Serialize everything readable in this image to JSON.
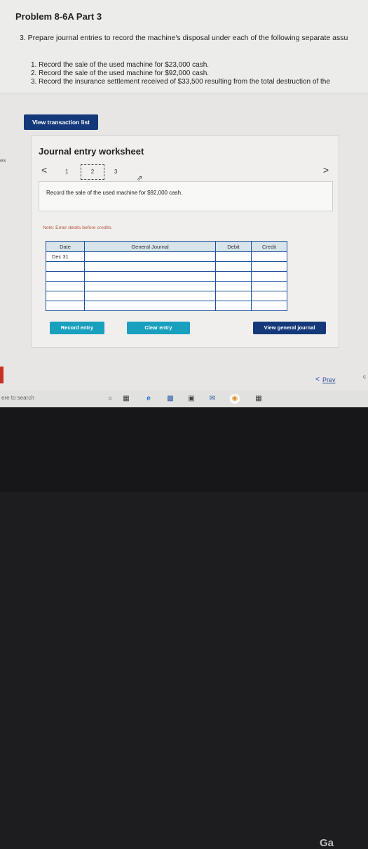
{
  "header": {
    "title": "Problem 8-6A Part 3",
    "question": "3. Prepare journal entries to record the machine's disposal under each of the following separate assu",
    "items": [
      "1. Record the sale of the used machine for $23,000 cash.",
      "2. Record the sale of the used machine for $92,000 cash.",
      "3. Record the insurance settlement received of $33,500 resulting from the total destruction of the"
    ]
  },
  "buttons": {
    "view_transactions": "View transaction list",
    "record_entry": "Record entry",
    "clear_entry": "Clear entry",
    "view_general_journal": "View general journal"
  },
  "left_cut_text": "es",
  "worksheet": {
    "title": "Journal entry worksheet",
    "nav_prev": "<",
    "nav_next": ">",
    "pages": [
      "1",
      "2",
      "3"
    ],
    "current_page": "2",
    "description": "Record the sale of the used machine for $92,000 cash.",
    "note": "Note: Enter debits before credits."
  },
  "journal_table": {
    "headers": [
      "Date",
      "General Journal",
      "Debit",
      "Credit"
    ],
    "rows": [
      [
        "Dec 31",
        "",
        "",
        ""
      ],
      [
        "",
        "",
        "",
        ""
      ],
      [
        "",
        "",
        "",
        ""
      ],
      [
        "",
        "",
        "",
        ""
      ],
      [
        "",
        "",
        "",
        ""
      ],
      [
        "",
        "",
        "",
        ""
      ]
    ]
  },
  "footer": {
    "prev_chevron": "<",
    "prev_label": "Prev",
    "edge_text": "c"
  },
  "taskbar": {
    "search_text": "ere to search"
  },
  "brand_text": "Ga",
  "colors": {
    "primary_button": "#13397a",
    "action_button": "#19a0bf",
    "table_border": "#1e4e9b",
    "note_text": "#b5563b"
  }
}
